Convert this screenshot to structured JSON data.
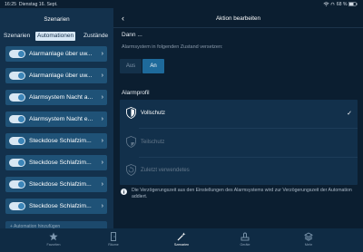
{
  "status_bar": {
    "time": "16:25",
    "date": "Dienstag 16. Sept.",
    "battery": "68 %"
  },
  "sidebar": {
    "title": "Szenarien",
    "tabs": [
      "Szenarien",
      "Automationen",
      "Zustände"
    ],
    "active_tab": "Automationen",
    "items": [
      {
        "label": "Alarmanlage über uw...",
        "enabled": true
      },
      {
        "label": "Alarmanlage über uw...",
        "enabled": true
      },
      {
        "label": "Alarmsystem Nacht a...",
        "enabled": true
      },
      {
        "label": "Alarmsystem Nacht e...",
        "enabled": true
      },
      {
        "label": "Steckdose Schlafzim...",
        "enabled": true
      },
      {
        "label": "Steckdose Schlafzim...",
        "enabled": true
      },
      {
        "label": "Steckdose Schlafzim...",
        "enabled": true
      },
      {
        "label": "Steckdose Schlafzim...",
        "enabled": true
      }
    ],
    "add_label": "+ Automation hinzufügen"
  },
  "main": {
    "title": "Aktion bearbeiten",
    "dann": "Dann ...",
    "alarm_desc": "Alarmsystem in folgenden Zustand versetzen:",
    "toggle": {
      "off": "Aus",
      "on": "An",
      "selected": "An"
    },
    "profil_label": "Alarmprofil",
    "profiles": [
      {
        "label": "Vollschutz",
        "icon": "shield-full-icon",
        "selected": true
      },
      {
        "label": "Teilschutz",
        "icon": "shield-partial-icon",
        "selected": false
      },
      {
        "label": "Zuletzt verwendetes",
        "icon": "shield-history-icon",
        "selected": false
      }
    ],
    "info_text": "Die Verzögerungszeit aus den Einstellungen des Alarmsystems wird zur Verzögerungszeit der Automation addiert."
  },
  "tabbar": {
    "items": [
      {
        "label": "Favoriten",
        "icon": "star-icon"
      },
      {
        "label": "Räume",
        "icon": "door-icon"
      },
      {
        "label": "Szenarien",
        "icon": "magic-wand-icon"
      },
      {
        "label": "Geräte",
        "icon": "device-icon"
      },
      {
        "label": "Mehr",
        "icon": "layers-icon"
      }
    ],
    "active": "Szenarien"
  },
  "colors": {
    "background": "#0b1e30",
    "sidebar": "#13314c",
    "item": "#1f5277",
    "accent": "#1e6a9b",
    "panel": "#12304b"
  }
}
